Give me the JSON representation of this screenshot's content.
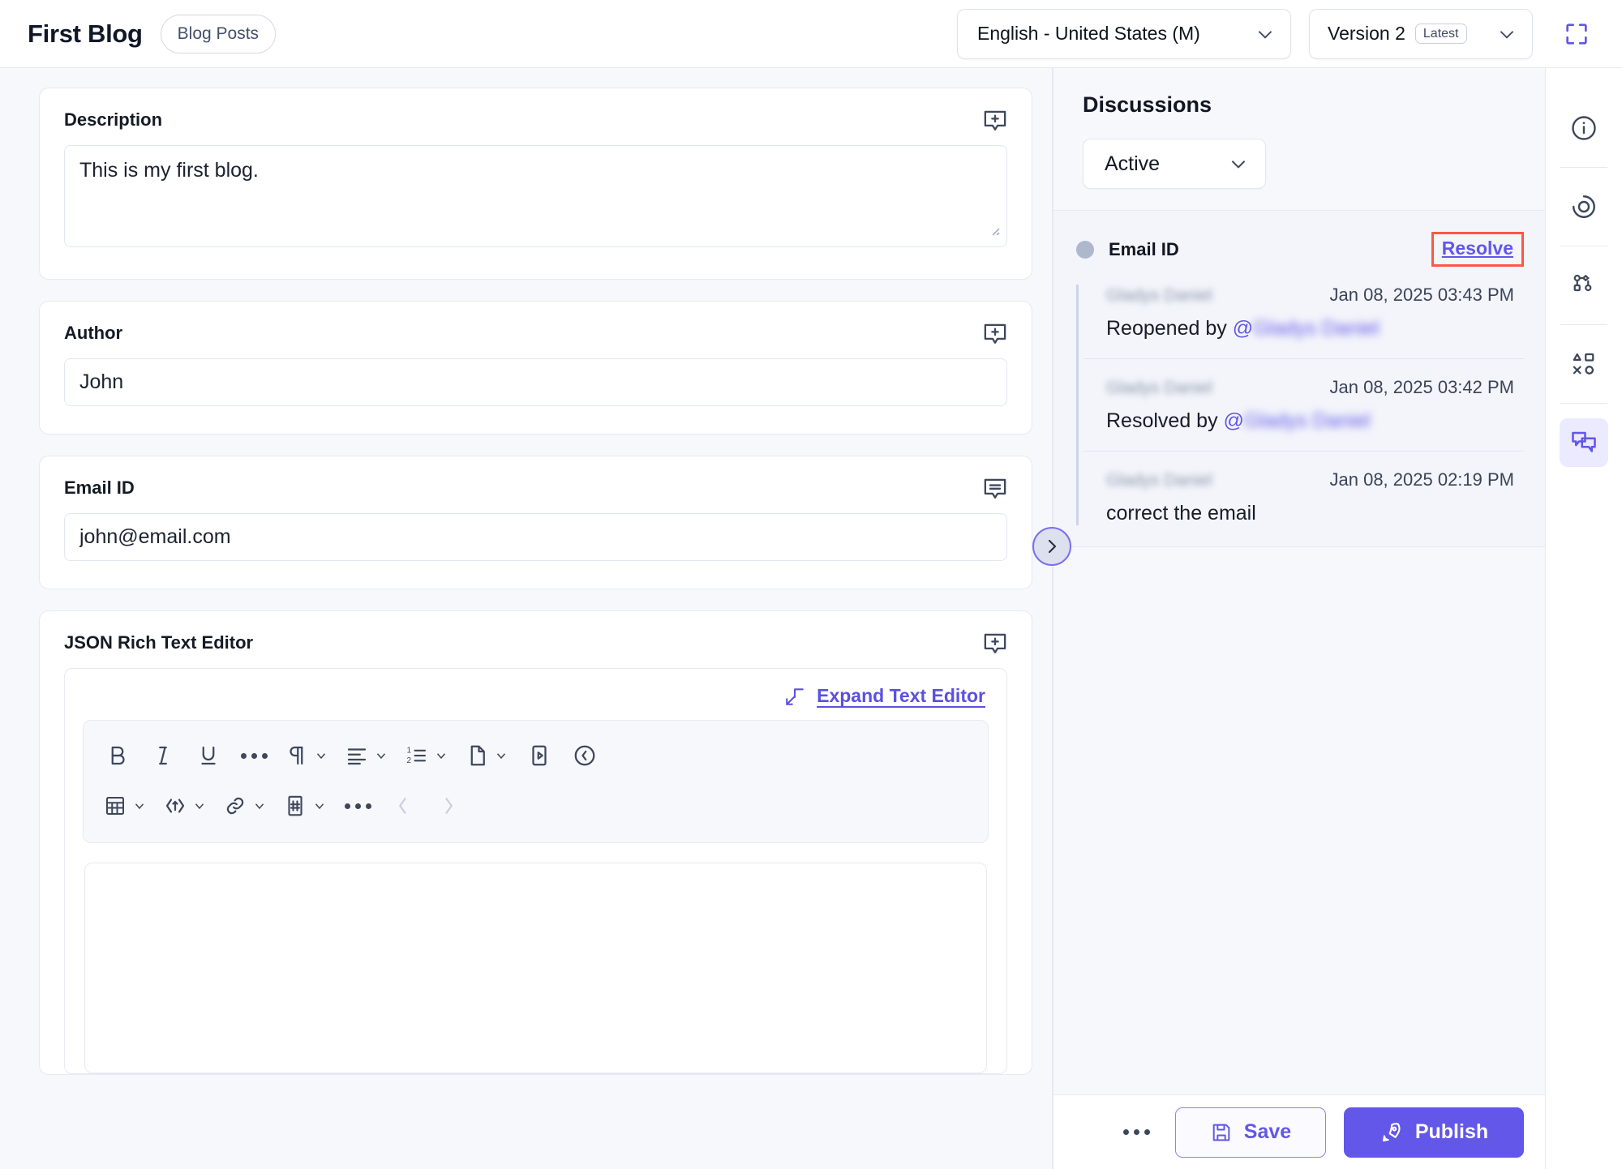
{
  "header": {
    "page_title": "First Blog",
    "breadcrumb_chip": "Blog Posts",
    "language_select": "English - United States (M)",
    "version_select": "Version 2",
    "version_badge": "Latest",
    "fullscreen_icon": "fullscreen-icon",
    "chevron_icon": "chevron-down-icon"
  },
  "form": {
    "fields": [
      {
        "label": "Description",
        "value": "This is my first blog.",
        "type": "textarea",
        "comment_icon": "add-comment-icon"
      },
      {
        "label": "Author",
        "value": "John",
        "type": "text",
        "comment_icon": "add-comment-icon"
      },
      {
        "label": "Email ID",
        "value": "john@email.com",
        "type": "text",
        "comment_icon": "view-comment-icon"
      }
    ],
    "rich_text": {
      "label": "JSON Rich Text Editor",
      "comment_icon": "add-comment-icon",
      "expand_label": "Expand Text Editor",
      "expand_icon": "expand-arrow-icon",
      "content": "",
      "toolbar_row_1": [
        {
          "name": "bold-icon",
          "label": "B",
          "caret": false,
          "disabled": false
        },
        {
          "name": "italic-icon",
          "label": "I",
          "caret": false,
          "disabled": false
        },
        {
          "name": "underline-icon",
          "label": "U",
          "caret": false,
          "disabled": false
        },
        {
          "name": "more-text-options-icon",
          "label": "",
          "caret": false,
          "disabled": false
        },
        {
          "name": "paragraph-style-icon",
          "label": "",
          "caret": true,
          "disabled": false
        },
        {
          "name": "text-align-icon",
          "label": "",
          "caret": true,
          "disabled": false
        },
        {
          "name": "ordered-list-icon",
          "label": "",
          "caret": true,
          "disabled": false
        },
        {
          "name": "insert-file-icon",
          "label": "",
          "caret": true,
          "disabled": false
        },
        {
          "name": "insert-media-icon",
          "label": "",
          "caret": false,
          "disabled": false
        },
        {
          "name": "source-code-icon",
          "label": "",
          "caret": false,
          "disabled": false
        }
      ],
      "toolbar_row_2": [
        {
          "name": "insert-table-icon",
          "label": "",
          "caret": true,
          "disabled": false
        },
        {
          "name": "embed-code-icon",
          "label": "",
          "caret": true,
          "disabled": false
        },
        {
          "name": "insert-link-icon",
          "label": "",
          "caret": true,
          "disabled": false
        },
        {
          "name": "anchor-hash-icon",
          "label": "",
          "caret": true,
          "disabled": false
        },
        {
          "name": "more-insert-options-icon",
          "label": "",
          "caret": false,
          "disabled": false
        },
        {
          "name": "undo-icon",
          "label": "",
          "caret": false,
          "disabled": true
        },
        {
          "name": "redo-icon",
          "label": "",
          "caret": false,
          "disabled": true
        }
      ]
    }
  },
  "discussions": {
    "title": "Discussions",
    "filter_value": "Active",
    "collapse_icon": "chevron-right-icon",
    "threads": [
      {
        "field": "Email ID",
        "resolve_label": "Resolve",
        "messages": [
          {
            "author": "Gladys Daniel",
            "time": "Jan 08, 2025 03:43 PM",
            "text_prefix": "Reopened by ",
            "mention": "Gladys Daniel"
          },
          {
            "author": "Gladys Daniel",
            "time": "Jan 08, 2025 03:42 PM",
            "text_prefix": "Resolved by ",
            "mention": "Gladys Daniel"
          },
          {
            "author": "Gladys Daniel",
            "time": "Jan 08, 2025 02:19 PM",
            "text_prefix": "correct the email",
            "mention": ""
          }
        ]
      }
    ]
  },
  "rail": [
    {
      "name": "info-icon",
      "active": false
    },
    {
      "name": "focus-target-icon",
      "active": false
    },
    {
      "name": "relations-sitemap-icon",
      "active": false
    },
    {
      "name": "content-blocks-icon",
      "active": false
    },
    {
      "name": "discussions-icon",
      "active": true
    }
  ],
  "footer": {
    "more_icon": "more-options-icon",
    "save_label": "Save",
    "save_icon": "save-disk-icon",
    "publish_label": "Publish",
    "publish_icon": "rocket-icon"
  },
  "colors": {
    "accent": "#6257e8",
    "highlight_box": "#fb5844",
    "panel_bg": "#f7f8fc",
    "thread_bg": "#f3f5fb"
  }
}
